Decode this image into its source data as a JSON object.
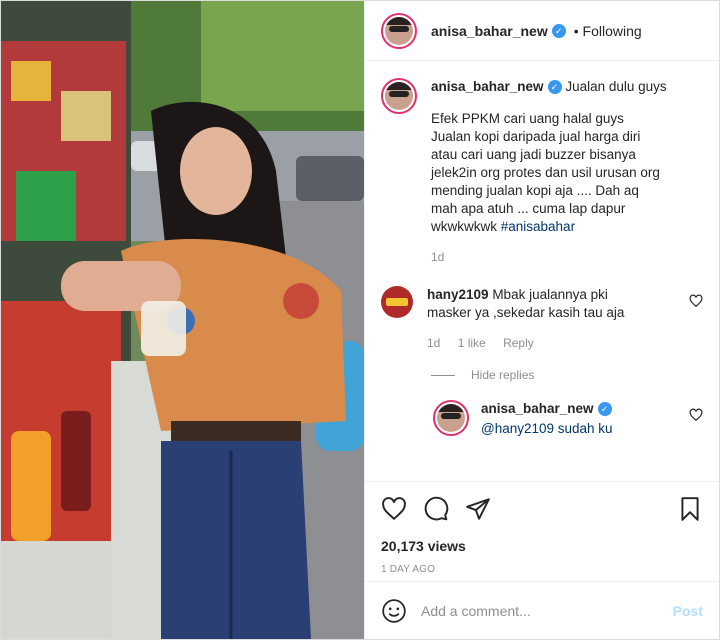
{
  "post": {
    "author": "anisa_bahar_new",
    "follow_status": "• Following",
    "caption_title": "Jualan dulu guys",
    "caption_body": "Efek PPKM cari uang halal guys Jualan kopi daripada jual harga diri atau cari uang jadi buzzer bisanya jelek2in org protes dan usil urusan org mending jualan kopi aja .... Dah aq mah apa atuh ... cuma lap dapur wkwkwkwk ",
    "hashtag": "#anisabahar",
    "caption_age": "1d"
  },
  "comments": [
    {
      "user": "hany2109",
      "text": "Mbak jualannya pki masker ya ,sekedar kasih tau aja",
      "age": "1d",
      "likes": "1 like",
      "reply_label": "Reply"
    }
  ],
  "hide_replies_label": "Hide replies",
  "reply": {
    "user": "anisa_bahar_new",
    "text": "@hany2109 sudah ku"
  },
  "stats": {
    "views": "20,173 views",
    "posted": "1 DAY AGO"
  },
  "composer": {
    "placeholder": "Add a comment...",
    "post_label": "Post"
  },
  "colors": {
    "verified": "#3897f0",
    "link": "#00376b",
    "post_disabled": "#b2dffc"
  }
}
